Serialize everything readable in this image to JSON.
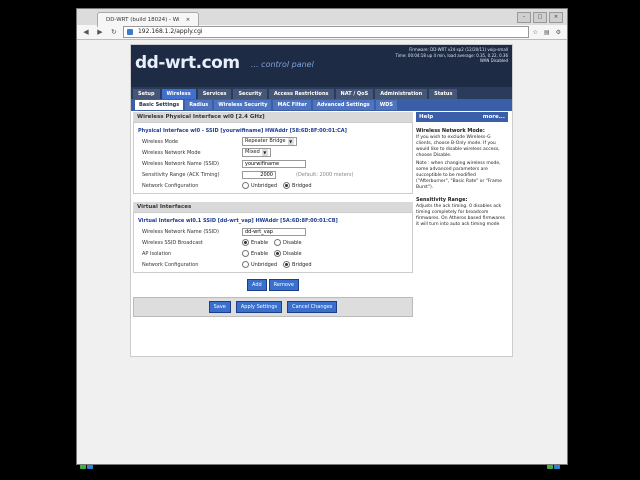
{
  "browser": {
    "tab_title": "DD-WRT (build 18024) - Wi",
    "url": "192.168.1.2/apply.cgi"
  },
  "router": {
    "logo": "dd-wrt.com",
    "logo_sub": "... control panel",
    "firmware": "Firmware: DD-WRT v24-sp2 (12/20/11) voip-small",
    "time": "Time: 00:04:18 up 4 min, load average: 0.35, 0.22, 0.36",
    "wan": "WAN Disabled"
  },
  "main_nav": [
    "Setup",
    "Wireless",
    "Services",
    "Security",
    "Access Restrictions",
    "NAT / QoS",
    "Administration",
    "Status"
  ],
  "sub_nav": [
    "Basic Settings",
    "Radius",
    "Wireless Security",
    "MAC Filter",
    "Advanced Settings",
    "WDS"
  ],
  "physical": {
    "section_title": "Wireless Physical Interface wl0 [2.4 GHz]",
    "iface_title": "Physical Interface wl0 - SSID [yourwifiname] HWAddr [58:6D:8F:00:01:CA]",
    "mode_label": "Wireless Mode",
    "mode_value": "Repeater Bridge",
    "netmode_label": "Wireless Network Mode",
    "netmode_value": "Mixed",
    "ssid_label": "Wireless Network Name (SSID)",
    "ssid_value": "yourwifiname",
    "sens_label": "Sensitivity Range (ACK Timing)",
    "sens_value": "2000",
    "sens_note": "(Default: 2000 meters)",
    "netconf_label": "Network Configuration",
    "unbridged": "Unbridged",
    "bridged": "Bridged"
  },
  "virtual": {
    "section_title": "Virtual Interfaces",
    "iface_title": "Virtual Interface wl0.1 SSID [dd-wrt_vap] HWAddr [5A:6D:8F:00:01:CB]",
    "ssid_label": "Wireless Network Name (SSID)",
    "ssid_value": "dd-wrt_vap",
    "broadcast_label": "Wireless SSID Broadcast",
    "ap_label": "AP Isolation",
    "netconf_label": "Network Configuration",
    "enable": "Enable",
    "disable": "Disable",
    "unbridged": "Unbridged",
    "bridged": "Bridged",
    "add": "Add",
    "remove": "Remove"
  },
  "buttons": {
    "save": "Save",
    "apply": "Apply Settings",
    "cancel": "Cancel Changes"
  },
  "help": {
    "title": "Help",
    "more": "more...",
    "h1": "Wireless Network Mode:",
    "p1": "If you wish to exclude Wireless-G clients, choose B-Only mode. If you would like to disable wireless access, choose Disable.",
    "p2": "Note : when changing wireless mode, some advanced parameters are succeptible to be modified (\"Afterburner\", \"Basic Rate\" or \"Frame Burst\").",
    "h2": "Sensitivity Range:",
    "p3": "Adjusts the ack timing. 0 disables ack timing completely for broadcom firmwares. On Atheros based firmwares it will turn into auto ack timing mode"
  }
}
